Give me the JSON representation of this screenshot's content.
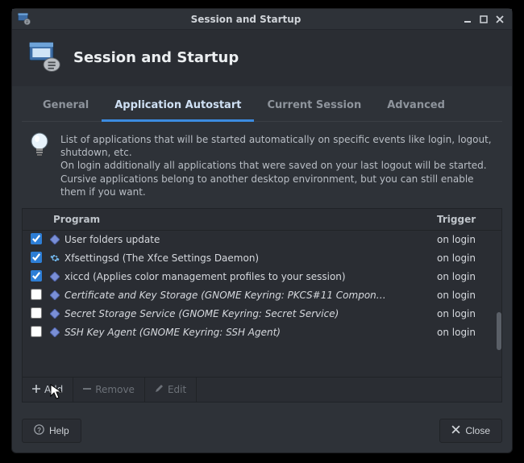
{
  "window": {
    "title": "Session and Startup"
  },
  "header": {
    "title": "Session and Startup"
  },
  "tabs": [
    {
      "id": "general",
      "label": "General",
      "active": false
    },
    {
      "id": "autostart",
      "label": "Application Autostart",
      "active": true
    },
    {
      "id": "current",
      "label": "Current Session",
      "active": false
    },
    {
      "id": "advanced",
      "label": "Advanced",
      "active": false
    }
  ],
  "note": {
    "line1": "List of applications that will be started automatically on specific events like login, logout, shutdown, etc.",
    "line2": "On login additionally all applications that were saved on your last logout will be started.",
    "line3": "Cursive applications belong to another desktop environment, but you can still enable them if you want."
  },
  "columns": {
    "program": "Program",
    "trigger": "Trigger"
  },
  "rows": [
    {
      "checked": true,
      "italic": false,
      "icon": "diamond",
      "label": "User folders update",
      "trigger": "on login"
    },
    {
      "checked": true,
      "italic": false,
      "icon": "gear",
      "label": "Xfsettingsd (The Xfce Settings Daemon)",
      "trigger": "on login"
    },
    {
      "checked": true,
      "italic": false,
      "icon": "diamond",
      "label": "xiccd (Applies color management profiles to your session)",
      "trigger": "on login"
    },
    {
      "checked": false,
      "italic": true,
      "icon": "diamond",
      "label": "Certificate and Key Storage (GNOME Keyring: PKCS#11 Compon…",
      "trigger": "on login"
    },
    {
      "checked": false,
      "italic": true,
      "icon": "diamond",
      "label": "Secret Storage Service (GNOME Keyring: Secret Service)",
      "trigger": "on login"
    },
    {
      "checked": false,
      "italic": true,
      "icon": "diamond",
      "label": "SSH Key Agent (GNOME Keyring: SSH Agent)",
      "trigger": "on login"
    }
  ],
  "toolbar": {
    "add": "Add",
    "remove": "Remove",
    "edit": "Edit"
  },
  "footer": {
    "help": "Help",
    "close": "Close"
  }
}
